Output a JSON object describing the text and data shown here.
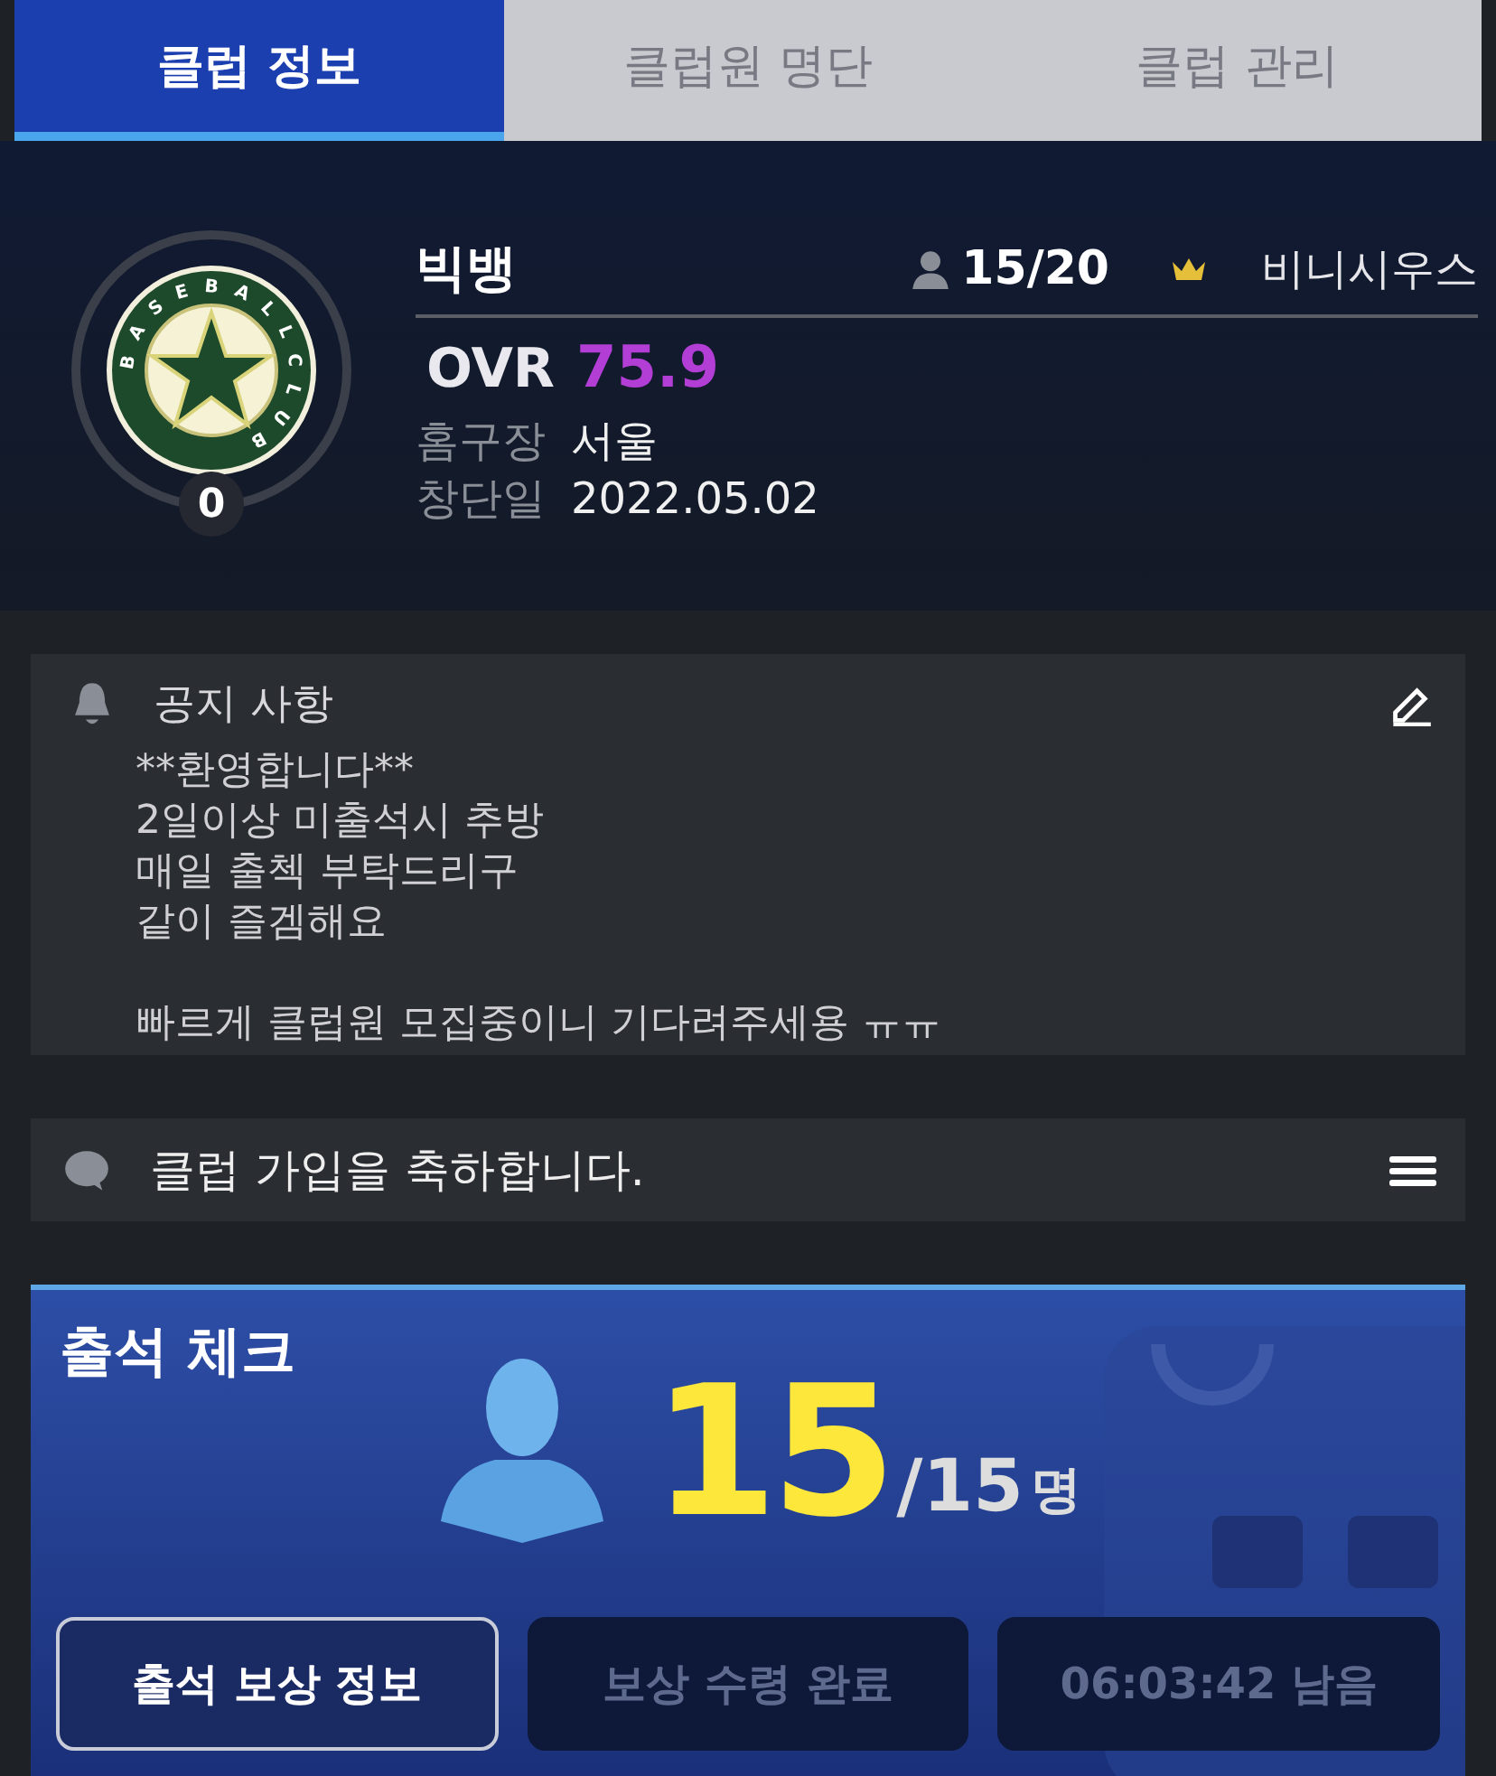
{
  "tabs": [
    {
      "label": "클럽 정보",
      "selected": true
    },
    {
      "label": "클럽원 명단",
      "selected": false
    },
    {
      "label": "클럽 관리",
      "selected": false
    }
  ],
  "club": {
    "logo_text": "BASEBALLCLUB",
    "level": "0",
    "name": "빅뱅",
    "members": "15/20",
    "leader": "비니시우스",
    "ovr_label": "OVR",
    "ovr": "75.9",
    "info": [
      {
        "label": "홈구장",
        "value": "서울"
      },
      {
        "label": "창단일",
        "value": "2022.05.02"
      }
    ]
  },
  "notice": {
    "title": "공지 사항",
    "paragraphs": [
      [
        "**환영합니다**",
        "2일이상 미출석시 추방",
        "매일 출첵 부탁드리구",
        "같이 즐겜해요"
      ],
      [
        "빠르게 클럽원 모집중이니 기다려주세용 ㅠㅠ"
      ]
    ]
  },
  "chat": {
    "message": "클럽 가입을 축하합니다."
  },
  "attendance": {
    "title": "출석 체크",
    "count": "15",
    "total": "/15",
    "unit": "명",
    "buttons": [
      {
        "label": "출석 보상 정보",
        "disabled": false
      },
      {
        "label": "보상 수령 완료",
        "disabled": true
      },
      {
        "label": "06:03:42 남음",
        "disabled": true
      }
    ]
  }
}
